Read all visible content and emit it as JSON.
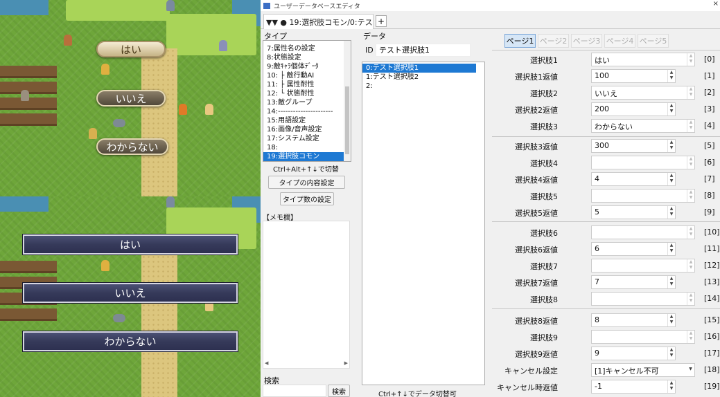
{
  "game": {
    "top_choices": [
      "はい",
      "いいえ",
      "わからない"
    ],
    "bottom_choices": [
      "はい",
      "いいえ",
      "わからない"
    ]
  },
  "editor": {
    "title": "ユーザーデータベースエディタ",
    "tab_label": "▼▼ ● 19:選択肢コモン/0:テス…",
    "plus_label": "+",
    "type_section_label": "タイプ",
    "type_items": [
      "7:属性名の設定",
      "8:状態設定",
      "9:敵ｷｬﾗ個体ﾃﾞｰﾀ",
      "10: ├ 敵行動AI",
      "11: ├ 属性耐性",
      "12: └ 状態耐性",
      "13:敵グループ",
      "14:----------------------",
      "15:用語設定",
      "16:画像/音声設定",
      "17:システム設定",
      "18:",
      "19:選択肢コモン"
    ],
    "type_selected_index": 12,
    "type_hint": "Ctrl+Alt+↑↓で切替",
    "type_content_button": "タイプの内容設定",
    "type_count_button": "タイプ数の設定",
    "memo_label": "【メモ欄】",
    "search_label": "検索",
    "search_button": "検索",
    "data_section_label": "データ",
    "id_label": "ID",
    "id_value": "テスト選択肢1",
    "data_items": [
      "0:テスト選択肢1",
      "1:テスト選択肢2",
      "2:"
    ],
    "data_selected_index": 0,
    "data_hint": "Ctrl+↑↓でデータ切替可",
    "pages": [
      "ページ1",
      "ページ2",
      "ページ3",
      "ページ4",
      "ページ5"
    ],
    "active_page": 0,
    "fields": [
      {
        "label": "選択肢1",
        "value": "はい",
        "index": "[0]",
        "kind": "text"
      },
      {
        "label": "選択肢1返値",
        "value": "100",
        "index": "[1]",
        "kind": "num"
      },
      {
        "label": "選択肢2",
        "value": "いいえ",
        "index": "[2]",
        "kind": "text"
      },
      {
        "label": "選択肢2返値",
        "value": "200",
        "index": "[3]",
        "kind": "num"
      },
      {
        "label": "選択肢3",
        "value": "わからない",
        "index": "[4]",
        "kind": "text"
      },
      {
        "label": "選択肢3返値",
        "value": "300",
        "index": "[5]",
        "kind": "num"
      },
      {
        "label": "選択肢4",
        "value": "",
        "index": "[6]",
        "kind": "text"
      },
      {
        "label": "選択肢4返値",
        "value": "4",
        "index": "[7]",
        "kind": "num"
      },
      {
        "label": "選択肢5",
        "value": "",
        "index": "[8]",
        "kind": "text"
      },
      {
        "label": "選択肢5返値",
        "value": "5",
        "index": "[9]",
        "kind": "num"
      },
      {
        "label": "選択肢6",
        "value": "",
        "index": "[10]",
        "kind": "text"
      },
      {
        "label": "選択肢6返値",
        "value": "6",
        "index": "[11]",
        "kind": "num"
      },
      {
        "label": "選択肢7",
        "value": "",
        "index": "[12]",
        "kind": "text"
      },
      {
        "label": "選択肢7返値",
        "value": "7",
        "index": "[13]",
        "kind": "num"
      },
      {
        "label": "選択肢8",
        "value": "",
        "index": "[14]",
        "kind": "text"
      },
      {
        "label": "選択肢8返値",
        "value": "8",
        "index": "[15]",
        "kind": "num"
      },
      {
        "label": "選択肢9",
        "value": "",
        "index": "[16]",
        "kind": "text"
      },
      {
        "label": "選択肢9返値",
        "value": "9",
        "index": "[17]",
        "kind": "num"
      },
      {
        "label": "キャンセル設定",
        "value": "[1]キャンセル不可",
        "index": "[18]",
        "kind": "select"
      },
      {
        "label": "キャンセル時返値",
        "value": "-1",
        "index": "[19]",
        "kind": "num"
      }
    ]
  }
}
